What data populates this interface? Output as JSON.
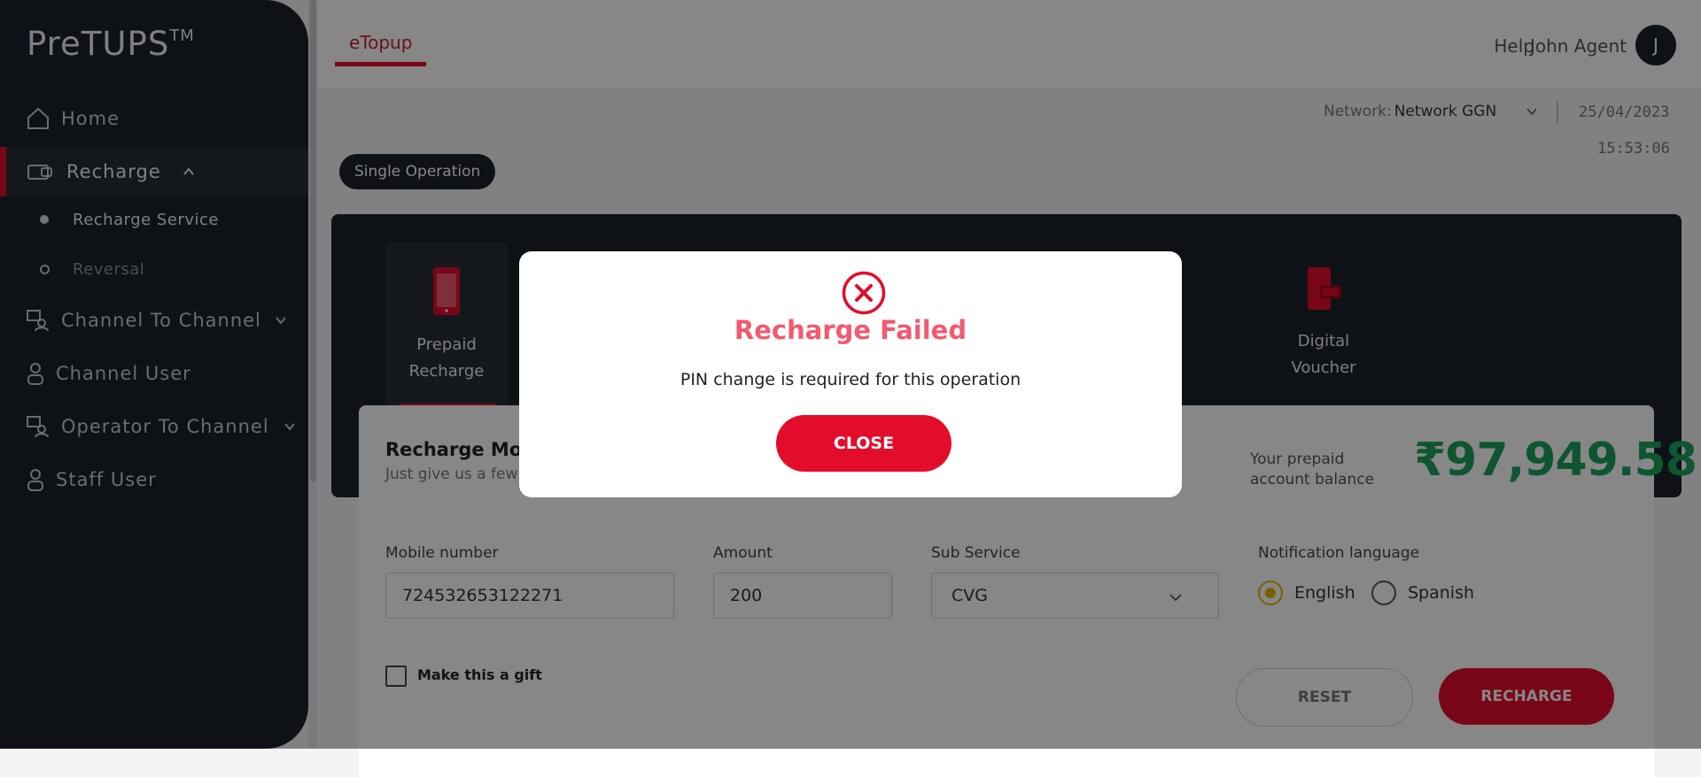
{
  "app": {
    "logo": "PreTUPS",
    "logo_tm": "TM"
  },
  "sidebar": {
    "items": [
      {
        "label": "Home",
        "icon": "home-icon"
      },
      {
        "label": "Recharge",
        "icon": "recharge-icon",
        "active": true,
        "expanded": true
      },
      {
        "label": "Channel To Channel",
        "icon": "channel-to-channel-icon"
      },
      {
        "label": "Channel User",
        "icon": "user-icon"
      },
      {
        "label": "Operator To Channel",
        "icon": "operator-to-channel-icon"
      },
      {
        "label": "Staff User",
        "icon": "user-icon"
      }
    ],
    "recharge_sub": [
      {
        "label": "Recharge Service",
        "selected": true
      },
      {
        "label": "Reversal",
        "selected": false
      }
    ]
  },
  "header": {
    "tab": "eTopup",
    "help": "Help",
    "user_name": "John Agent",
    "avatar_initial": "J"
  },
  "network": {
    "label": "Network:",
    "value": "Network GGN"
  },
  "datetime": {
    "date": "25/04/2023",
    "time": "15:53:06"
  },
  "operation_mode": "Single Operation",
  "services": [
    {
      "line1": "Prepaid",
      "line2": "Recharge",
      "icon": "mobile-phone-icon",
      "active": true
    },
    {
      "line1": "Digital",
      "line2": "Voucher",
      "icon": "digital-voucher-icon",
      "active": false
    }
  ],
  "form": {
    "title": "Recharge Mob",
    "subtitle": "Just give us a few",
    "balance_label_1": "Your prepaid",
    "balance_label_2": "account balance",
    "balance": "₹97,949.58",
    "mobile_label": "Mobile number",
    "mobile_value": "724532653122271",
    "amount_label": "Amount",
    "amount_value": "200",
    "sub_service_label": "Sub Service",
    "sub_service_value": "CVG",
    "notif_label": "Notification language",
    "lang_english": "English",
    "lang_spanish": "Spanish",
    "selected_language": "English",
    "gift_label": "Make this a gift",
    "reset_label": "RESET",
    "recharge_label": "RECHARGE"
  },
  "modal": {
    "icon": "error-circle-icon",
    "title": "Recharge Failed",
    "message": "PIN change is required for this operation",
    "close_label": "CLOSE"
  },
  "colors": {
    "sidebar_bg": "#1b222c",
    "accent_red": "#e40c2b",
    "error_title": "#f25a6f",
    "balance_green": "#1ca35a",
    "radio_selected": "#e3b400"
  }
}
